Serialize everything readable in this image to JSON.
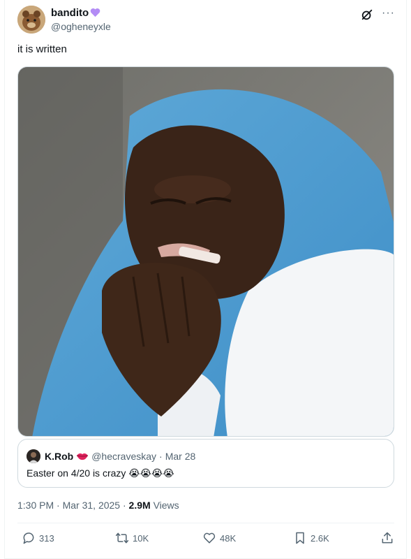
{
  "author": {
    "name": "bandito",
    "handle": "@ogheneyxle"
  },
  "tweet": {
    "text": "it is written"
  },
  "media": {
    "alt": "photo"
  },
  "quote": {
    "name": "K.Rob",
    "handle": "@hecraveskay",
    "separator": "·",
    "date": "Mar 28",
    "text": "Easter on 4/20 is crazy 😭😭😭😭"
  },
  "meta": {
    "time": "1:30 PM",
    "separator": "·",
    "date": "Mar 31, 2025",
    "views_count": "2.9M",
    "views_label": "Views"
  },
  "actions": {
    "replies": "313",
    "reposts": "10K",
    "likes": "48K",
    "bookmarks": "2.6K"
  },
  "colors": {
    "accent_heart": "#b38cf5",
    "quote_lips": "#e0245e",
    "muted": "#536471"
  }
}
